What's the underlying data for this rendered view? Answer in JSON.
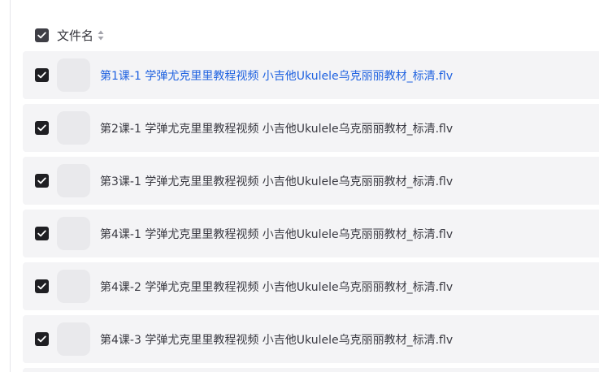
{
  "header": {
    "column_label": "文件名",
    "sort_icon": "sort-updown-icon",
    "select_all_checked": true
  },
  "colors": {
    "active_link": "#1f62e0",
    "row_background": "#f4f4f6",
    "checkbox": "#1f1f23"
  },
  "files": [
    {
      "name": "第1课-1 学弹尤克里里教程视频 小吉他Ukulele乌克丽丽教材_标清.flv",
      "checked": true,
      "active": true,
      "thumb_icon": "video-thumbnail"
    },
    {
      "name": "第2课-1 学弹尤克里里教程视频 小吉他Ukulele乌克丽丽教材_标清.flv",
      "checked": true,
      "active": false,
      "thumb_icon": "video-thumbnail"
    },
    {
      "name": "第3课-1 学弹尤克里里教程视频 小吉他Ukulele乌克丽丽教材_标清.flv",
      "checked": true,
      "active": false,
      "thumb_icon": "video-thumbnail"
    },
    {
      "name": "第4课-1 学弹尤克里里教程视频 小吉他Ukulele乌克丽丽教材_标清.flv",
      "checked": true,
      "active": false,
      "thumb_icon": "video-thumbnail"
    },
    {
      "name": "第4课-2 学弹尤克里里教程视频 小吉他Ukulele乌克丽丽教材_标清.flv",
      "checked": true,
      "active": false,
      "thumb_icon": "video-thumbnail"
    },
    {
      "name": "第4课-3 学弹尤克里里教程视频 小吉他Ukulele乌克丽丽教材_标清.flv",
      "checked": true,
      "active": false,
      "thumb_icon": "video-thumbnail"
    }
  ]
}
